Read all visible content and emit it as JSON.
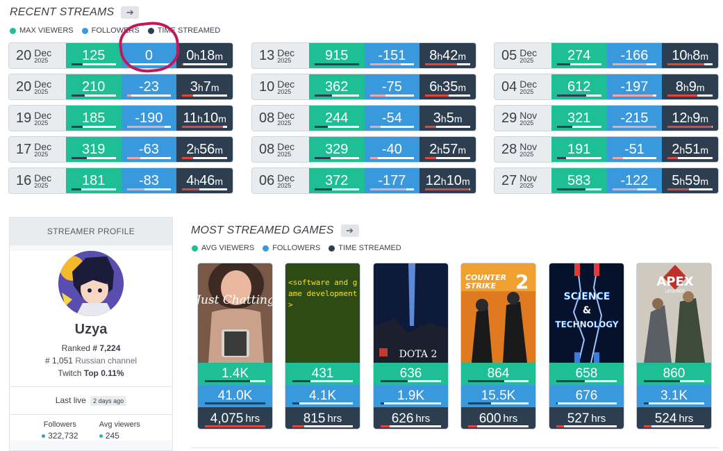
{
  "recent": {
    "title": "RECENT STREAMS",
    "legend": [
      "MAX VIEWERS",
      "FOLLOWERS",
      "TIME STREAMED"
    ],
    "colors": {
      "views": "#1fbf95",
      "followers": "#3a98dc",
      "time": "#2c3e50",
      "bar_red": "#e2473d",
      "highlight": "#c2185b"
    },
    "streams": [
      {
        "day": "20",
        "mon": "Dec",
        "year": "2025",
        "views": "125",
        "foll": "0",
        "th": "0",
        "tm": "18",
        "vf": 0.25,
        "ff": 0.0,
        "tf": 0.02
      },
      {
        "day": "20",
        "mon": "Dec",
        "year": "2025",
        "views": "210",
        "foll": "-23",
        "th": "3",
        "tm": "7",
        "vf": 0.3,
        "ff": 0.1,
        "tf": 0.25
      },
      {
        "day": "19",
        "mon": "Dec",
        "year": "2025",
        "views": "185",
        "foll": "-190",
        "th": "11",
        "tm": "10",
        "vf": 0.25,
        "ff": 0.85,
        "tf": 0.9
      },
      {
        "day": "17",
        "mon": "Dec",
        "year": "2025",
        "views": "319",
        "foll": "-63",
        "th": "2",
        "tm": "56",
        "vf": 0.35,
        "ff": 0.3,
        "tf": 0.25
      },
      {
        "day": "16",
        "mon": "Dec",
        "year": "2025",
        "views": "181",
        "foll": "-83",
        "th": "4",
        "tm": "46",
        "vf": 0.22,
        "ff": 0.4,
        "tf": 0.38
      },
      {
        "day": "13",
        "mon": "Dec",
        "year": "2025",
        "views": "915",
        "foll": "-151",
        "th": "8",
        "tm": "42",
        "vf": 1.0,
        "ff": 0.7,
        "tf": 0.7
      },
      {
        "day": "10",
        "mon": "Dec",
        "year": "2025",
        "views": "362",
        "foll": "-75",
        "th": "6",
        "tm": "35",
        "vf": 0.4,
        "ff": 0.35,
        "tf": 0.52
      },
      {
        "day": "08",
        "mon": "Dec",
        "year": "2025",
        "views": "244",
        "foll": "-54",
        "th": "3",
        "tm": "5",
        "vf": 0.3,
        "ff": 0.25,
        "tf": 0.25
      },
      {
        "day": "08",
        "mon": "Dec",
        "year": "2025",
        "views": "329",
        "foll": "-40",
        "th": "2",
        "tm": "57",
        "vf": 0.36,
        "ff": 0.18,
        "tf": 0.24
      },
      {
        "day": "06",
        "mon": "Dec",
        "year": "2025",
        "views": "372",
        "foll": "-177",
        "th": "12",
        "tm": "10",
        "vf": 0.4,
        "ff": 0.82,
        "tf": 0.98
      },
      {
        "day": "05",
        "mon": "Dec",
        "year": "2025",
        "views": "274",
        "foll": "-166",
        "th": "10",
        "tm": "8",
        "vf": 0.3,
        "ff": 0.77,
        "tf": 0.82
      },
      {
        "day": "04",
        "mon": "Dec",
        "year": "2025",
        "views": "612",
        "foll": "-197",
        "th": "8",
        "tm": "9",
        "vf": 0.67,
        "ff": 0.92,
        "tf": 0.66
      },
      {
        "day": "29",
        "mon": "Nov",
        "year": "2025",
        "views": "321",
        "foll": "-215",
        "th": "12",
        "tm": "9",
        "vf": 0.35,
        "ff": 1.0,
        "tf": 0.98
      },
      {
        "day": "28",
        "mon": "Nov",
        "year": "2025",
        "views": "191",
        "foll": "-51",
        "th": "2",
        "tm": "51",
        "vf": 0.21,
        "ff": 0.24,
        "tf": 0.23
      },
      {
        "day": "27",
        "mon": "Nov",
        "year": "2025",
        "views": "583",
        "foll": "-122",
        "th": "5",
        "tm": "59",
        "vf": 0.64,
        "ff": 0.57,
        "tf": 0.48
      }
    ]
  },
  "profile": {
    "header": "STREAMER PROFILE",
    "name": "Uzya",
    "ranked_label": "Ranked",
    "ranked_value": "# 7,224",
    "channel_rank": "# 1,051",
    "channel_label": "Russian channel",
    "platform": "Twitch",
    "top_label": "Top 0.11%",
    "last_live_label": "Last live",
    "last_live_value": "2 days ago",
    "followers_label": "Followers",
    "followers_value": "322,732",
    "avg_label": "Avg viewers",
    "avg_value": "245"
  },
  "games": {
    "title": "MOST STREAMED GAMES",
    "legend": [
      "AVG VIEWERS",
      "FOLLOWERS",
      "TIME STREAMED"
    ],
    "items": [
      {
        "name": "Just Chatting",
        "avg": "1.4K",
        "fol": "41.0K",
        "hrs": "4,075",
        "unit": "hrs",
        "af": 0.75,
        "ff": 1.0,
        "tf": 1.0
      },
      {
        "name": "Software and Game Development",
        "avg": "431",
        "fol": "4.1K",
        "hrs": "815",
        "unit": "hrs",
        "af": 0.3,
        "ff": 0.12,
        "tf": 0.2
      },
      {
        "name": "DOTA 2",
        "avg": "636",
        "fol": "1.9K",
        "hrs": "626",
        "unit": "hrs",
        "af": 0.45,
        "ff": 0.06,
        "tf": 0.15
      },
      {
        "name": "Counter-Strike 2",
        "avg": "864",
        "fol": "15.5K",
        "hrs": "600",
        "unit": "hrs",
        "af": 0.6,
        "ff": 0.38,
        "tf": 0.15
      },
      {
        "name": "Science & Technology",
        "avg": "658",
        "fol": "676",
        "hrs": "527",
        "unit": "hrs",
        "af": 0.47,
        "ff": 0.02,
        "tf": 0.13
      },
      {
        "name": "Apex Legends",
        "avg": "860",
        "fol": "3.1K",
        "hrs": "524",
        "unit": "hrs",
        "af": 0.6,
        "ff": 0.08,
        "tf": 0.13
      }
    ],
    "art_text": {
      "just_chatting": "Just Chatting",
      "software_code": "<software and game development>",
      "dota": "DOTA 2",
      "cs_line1": "COUNTER",
      "cs_line2": "STRIKE",
      "cs_num": "2",
      "sci_1": "SCIENCE",
      "sci_2": "&",
      "sci_3": "TECHNOLOGY",
      "apex": "APEX",
      "apex_sub": "LEGENDS"
    }
  },
  "icons": {
    "arrow": "arrow-right-icon"
  }
}
